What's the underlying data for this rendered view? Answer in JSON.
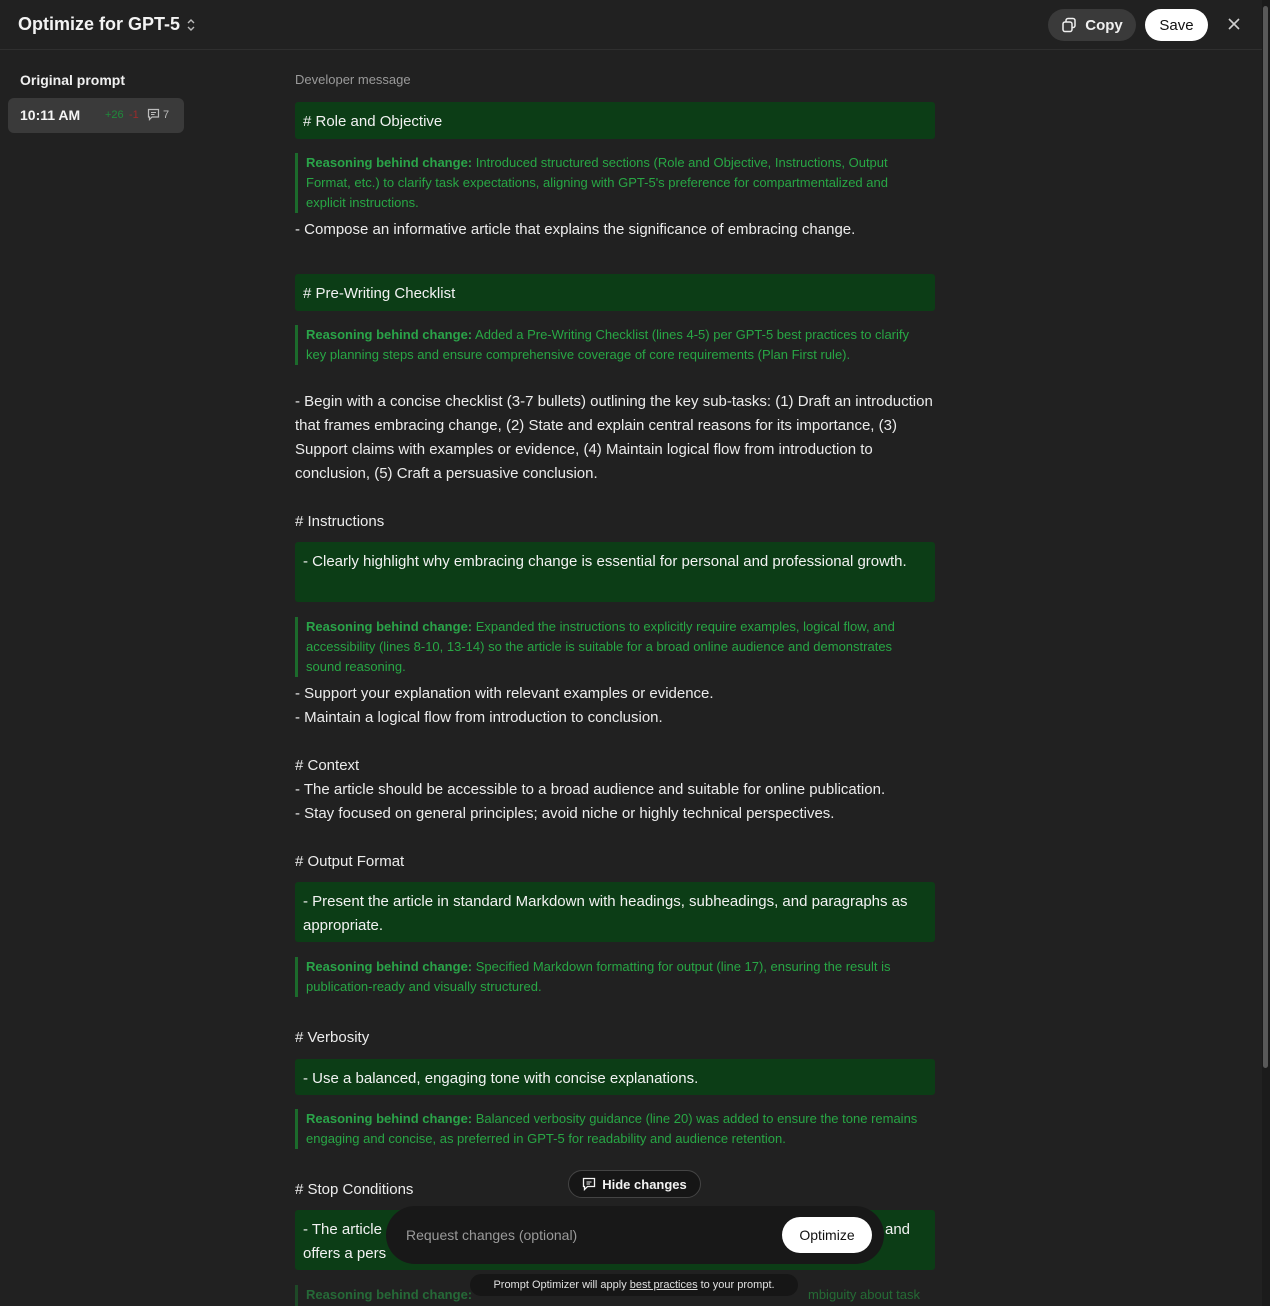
{
  "header": {
    "title": "Optimize for GPT-5",
    "copy_label": "Copy",
    "save_label": "Save"
  },
  "sidebar": {
    "heading": "Original prompt",
    "versions": [
      {
        "time": "10:11 AM",
        "added": "+26",
        "removed": "-1",
        "comments": "7"
      }
    ]
  },
  "main": {
    "section_label": "Developer message",
    "reason_prefix": "Reasoning behind change:",
    "blocks": {
      "role_heading": "# Role and Objective",
      "role_reason": "Introduced structured sections (Role and Objective, Instructions, Output Format, etc.) to clarify task expectations, aligning with GPT-5's preference for compartmentalized and explicit instructions.",
      "role_text": "- Compose an informative article that explains the significance of embracing change.",
      "checklist_heading": "# Pre-Writing Checklist",
      "checklist_reason": "Added a Pre-Writing Checklist (lines 4-5) per GPT-5 best practices to clarify key planning steps and ensure comprehensive coverage of core requirements (Plan First rule).",
      "checklist_text": "- Begin with a concise checklist (3-7 bullets) outlining the key sub-tasks: (1) Draft an introduction that frames embracing change, (2) State and explain central reasons for its importance, (3) Support claims with examples or evidence, (4) Maintain logical flow from introduction to conclusion, (5) Craft a persuasive conclusion.",
      "instructions_heading": "# Instructions",
      "instructions_highlight": "- Clearly highlight why embracing change is essential for personal and professional growth.",
      "instructions_reason": "Expanded the instructions to explicitly require examples, logical flow, and accessibility (lines 8-10, 13-14) so the article is suitable for a broad online audience and demonstrates sound reasoning.",
      "instructions_line1": "- Support your explanation with relevant examples or evidence.",
      "instructions_line2": "- Maintain a logical flow from introduction to conclusion.",
      "context_heading": "# Context",
      "context_line1": "- The article should be accessible to a broad audience and suitable for online publication.",
      "context_line2": "- Stay focused on general principles; avoid niche or highly technical perspectives.",
      "output_heading": "# Output Format",
      "output_highlight": "- Present the article in standard Markdown with headings, subheadings, and paragraphs as appropriate.",
      "output_reason": "Specified Markdown formatting for output (line 17), ensuring the result is publication-ready and visually structured.",
      "verbosity_heading": "# Verbosity",
      "verbosity_highlight": "- Use a balanced, engaging tone with concise explanations.",
      "verbosity_reason": "Balanced verbosity guidance (line 20) was added to ensure the tone remains engaging and concise, as preferred in GPT-5 for readability and audience retention.",
      "stop_heading": "# Stop Conditions",
      "stop_highlight_start": "- The article",
      "stop_highlight_end": "and",
      "stop_highlight_line2": "offers a pers",
      "stop_reason_start": "Reasoning behind change:",
      "stop_reason_end": "mbiguity about task"
    }
  },
  "bottom": {
    "hide_changes_label": "Hide changes",
    "request_placeholder": "Request changes (optional)",
    "optimize_label": "Optimize",
    "footnote_before": "Prompt Optimizer will apply",
    "footnote_link": "best practices",
    "footnote_after": "to your prompt."
  },
  "colors": {
    "background": "#212121",
    "highlight_bg": "#0c3d16",
    "reason_green": "#28a745"
  }
}
